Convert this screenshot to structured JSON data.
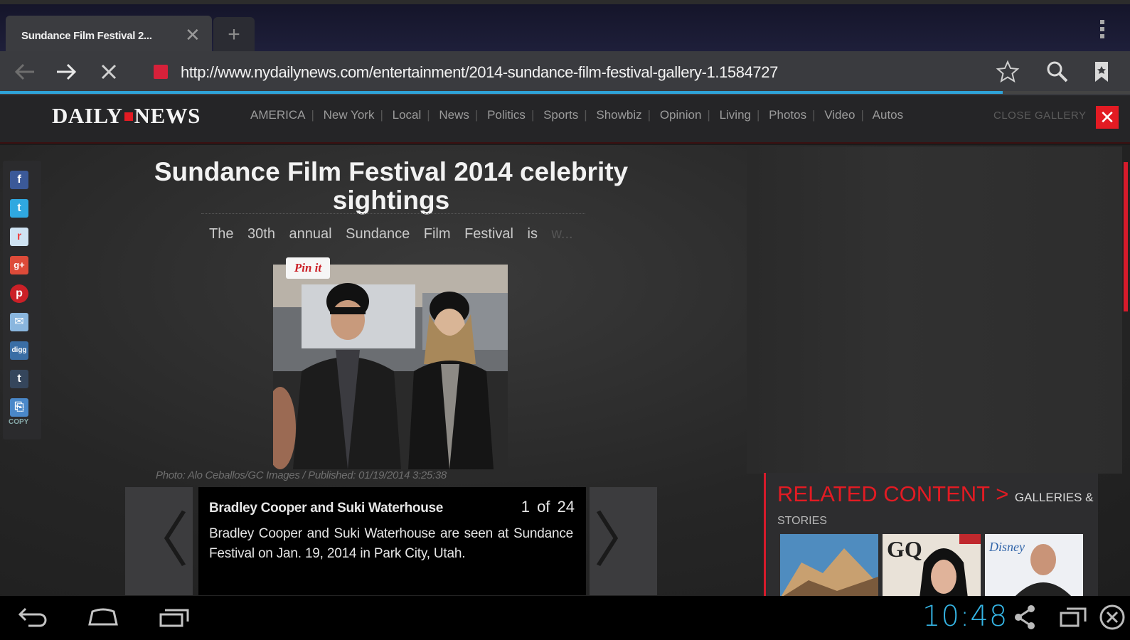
{
  "browser": {
    "tab_title": "Sundance Film Festival 2...",
    "new_tab_glyph": "+",
    "url": "http://www.nydailynews.com/entertainment/2014-sundance-film-festival-gallery-1.1584727",
    "icons": [
      "back-icon",
      "forward-icon",
      "stop-icon",
      "star-icon",
      "search-icon",
      "bookmarks-icon",
      "overflow-menu-icon"
    ],
    "accent_color": "#2fa3d8"
  },
  "site": {
    "logo_left": "DAILY",
    "logo_right": "NEWS",
    "nav": [
      "AMERICA",
      "New York",
      "Local",
      "News",
      "Politics",
      "Sports",
      "Showbiz",
      "Opinion",
      "Living",
      "Photos",
      "Video",
      "Autos"
    ],
    "close_gallery": "CLOSE GALLERY",
    "close_x": "✕",
    "brand_color": "#e31b23"
  },
  "social": {
    "icons": [
      "facebook-icon",
      "twitter-icon",
      "reddit-icon",
      "google-plus-icon",
      "pinterest-icon",
      "email-icon",
      "digg-icon",
      "tumblr-icon",
      "copy-link-icon"
    ],
    "copy_label": "COPY"
  },
  "gallery": {
    "headline": "Sundance Film Festival 2014 celebrity sightings",
    "lede": "The 30th annual Sundance Film Festival is",
    "lede_fade": "w...",
    "pin_it": "Pin it",
    "credit": "Photo: Alo Ceballos/GC Images / Published: 01/19/2014 3:25:38",
    "caption_title": "Bradley Cooper and Suki Waterhouse",
    "counter": "1 of 24",
    "caption_text": "Bradley Cooper and Suki Waterhouse are seen at Sundance Festival on Jan. 19, 2014 in Park City, Utah.",
    "prev_glyph": "〈",
    "next_glyph": "〉"
  },
  "related": {
    "title": "RELATED CONTENT",
    "arrow": ">",
    "sub": "GALLERIES &",
    "sub2": "STORIES"
  },
  "system": {
    "clock": "10:48",
    "icons": [
      "back-nav-icon",
      "home-nav-icon",
      "recent-apps-icon",
      "share-icon",
      "window-icon",
      "close-app-icon"
    ]
  }
}
